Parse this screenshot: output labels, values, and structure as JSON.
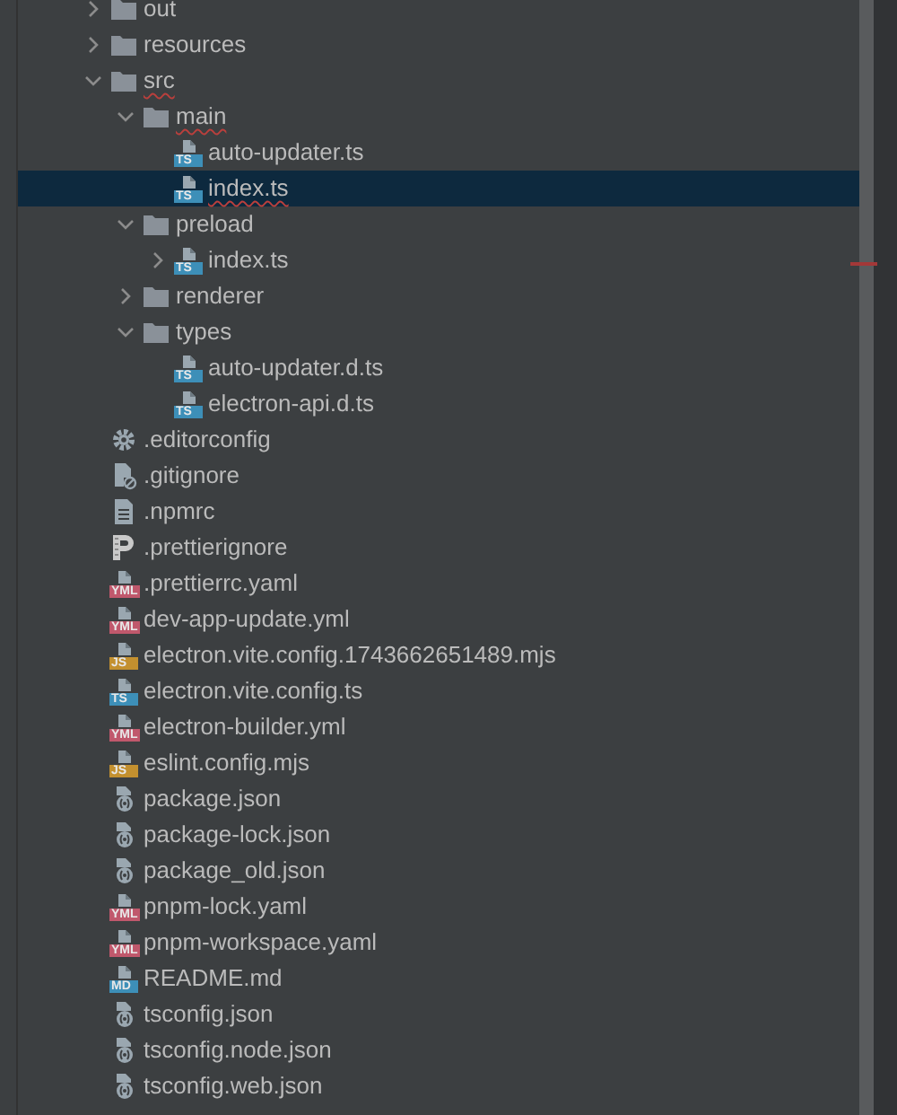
{
  "tree": [
    {
      "name": "out",
      "kind": "folder",
      "expanded": false,
      "selected": false
    },
    {
      "name": "resources",
      "kind": "folder",
      "expanded": false,
      "selected": false
    },
    {
      "name": "src",
      "kind": "folder",
      "expanded": true,
      "selected": false,
      "error": true,
      "children": [
        {
          "name": "main",
          "kind": "folder",
          "expanded": true,
          "selected": false,
          "error": true,
          "children": [
            {
              "name": "auto-updater.ts",
              "kind": "ts",
              "badge": "TS",
              "selected": false
            },
            {
              "name": "index.ts",
              "kind": "ts",
              "badge": "TS",
              "selected": true,
              "error": true
            }
          ]
        },
        {
          "name": "preload",
          "kind": "folder",
          "expanded": true,
          "selected": false,
          "children": [
            {
              "name": "index.ts",
              "kind": "ts",
              "badge": "TS",
              "expanded": false,
              "selected": false
            }
          ]
        },
        {
          "name": "renderer",
          "kind": "folder",
          "expanded": false,
          "selected": false
        },
        {
          "name": "types",
          "kind": "folder",
          "expanded": true,
          "selected": false,
          "children": [
            {
              "name": "auto-updater.d.ts",
              "kind": "ts",
              "badge": "TS",
              "selected": false
            },
            {
              "name": "electron-api.d.ts",
              "kind": "ts",
              "badge": "TS",
              "selected": false
            }
          ]
        }
      ]
    },
    {
      "name": ".editorconfig",
      "kind": "settings",
      "selected": false
    },
    {
      "name": ".gitignore",
      "kind": "ignore",
      "selected": false
    },
    {
      "name": ".npmrc",
      "kind": "text",
      "selected": false
    },
    {
      "name": ".prettierignore",
      "kind": "prettier",
      "selected": false
    },
    {
      "name": ".prettierrc.yaml",
      "kind": "yml",
      "badge": "YML",
      "selected": false
    },
    {
      "name": "dev-app-update.yml",
      "kind": "yml",
      "badge": "YML",
      "selected": false
    },
    {
      "name": "electron.vite.config.1743662651489.mjs",
      "kind": "js",
      "badge": "JS",
      "selected": false
    },
    {
      "name": "electron.vite.config.ts",
      "kind": "ts",
      "badge": "TS",
      "selected": false
    },
    {
      "name": "electron-builder.yml",
      "kind": "yml",
      "badge": "YML",
      "selected": false
    },
    {
      "name": "eslint.config.mjs",
      "kind": "js",
      "badge": "JS",
      "selected": false
    },
    {
      "name": "package.json",
      "kind": "json",
      "selected": false
    },
    {
      "name": "package-lock.json",
      "kind": "json",
      "selected": false
    },
    {
      "name": "package_old.json",
      "kind": "json",
      "selected": false
    },
    {
      "name": "pnpm-lock.yaml",
      "kind": "yml",
      "badge": "YML",
      "selected": false
    },
    {
      "name": "pnpm-workspace.yaml",
      "kind": "yml",
      "badge": "YML",
      "selected": false
    },
    {
      "name": "README.md",
      "kind": "md",
      "badge": "MD",
      "selected": false
    },
    {
      "name": "tsconfig.json",
      "kind": "json",
      "selected": false
    },
    {
      "name": "tsconfig.node.json",
      "kind": "json",
      "selected": false
    },
    {
      "name": "tsconfig.web.json",
      "kind": "json",
      "selected": false
    }
  ]
}
